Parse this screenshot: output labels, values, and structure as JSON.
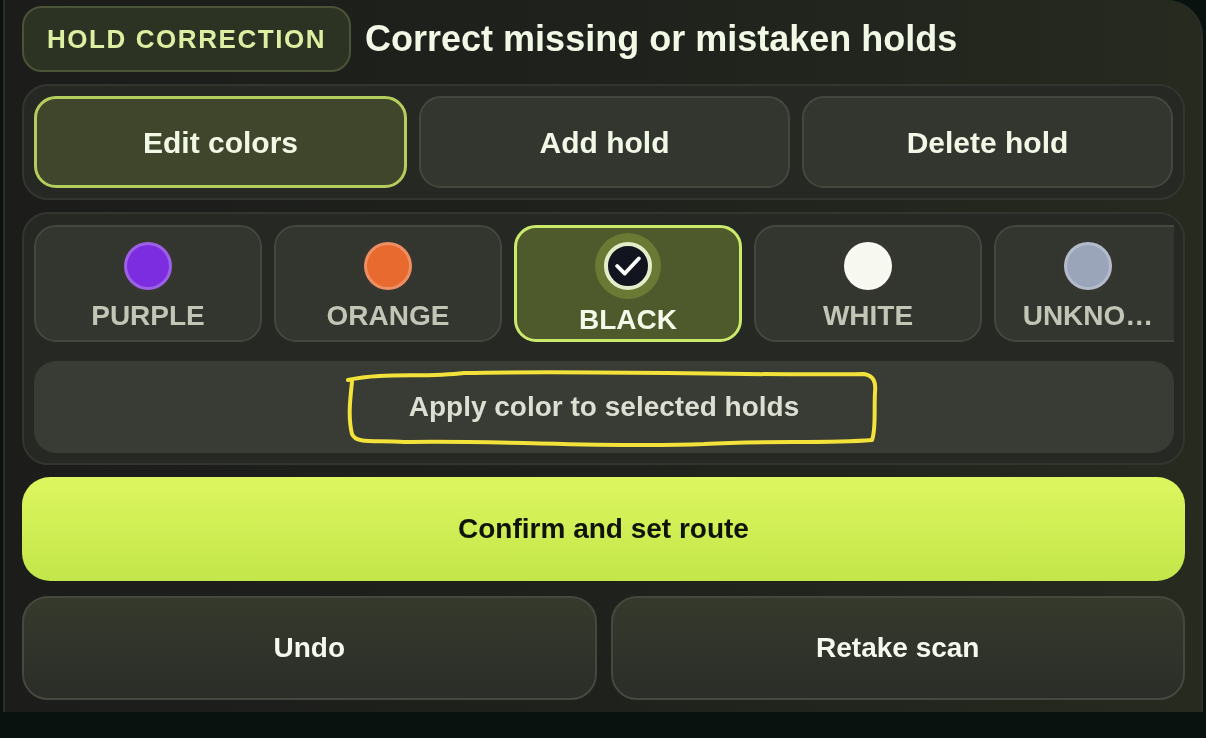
{
  "header": {
    "badge": "HOLD CORRECTION",
    "title": "Correct missing or mistaken holds"
  },
  "modes": [
    {
      "label": "Edit colors",
      "selected": true
    },
    {
      "label": "Add hold",
      "selected": false
    },
    {
      "label": "Delete hold",
      "selected": false
    }
  ],
  "colors": [
    {
      "label": "PURPLE",
      "color": "#7d2de0",
      "selected": false
    },
    {
      "label": "ORANGE",
      "color": "#e96a2f",
      "selected": false
    },
    {
      "label": "BLACK",
      "color": "#12151f",
      "selected": true
    },
    {
      "label": "WHITE",
      "color": "#f7f9f1",
      "selected": false
    },
    {
      "label": "UNKNO…",
      "color": "#9ba5ba",
      "selected": false
    }
  ],
  "apply_button": {
    "label": "Apply color to selected holds",
    "highlighted": true
  },
  "primary_button": {
    "label": "Confirm and set route"
  },
  "secondary_buttons": [
    "Undo",
    "Retake scan"
  ]
}
